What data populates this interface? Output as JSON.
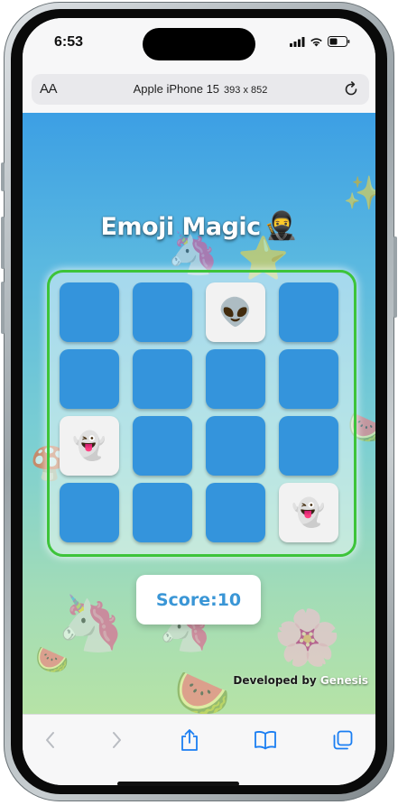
{
  "status_bar": {
    "time": "6:53"
  },
  "address_bar": {
    "text_size_label": "AA",
    "device_name": "Apple iPhone 15",
    "device_dimensions": "393 x 852"
  },
  "game": {
    "title": "Emoji Magic",
    "title_icon": "🥷",
    "cards": [
      {
        "revealed": false,
        "emoji": ""
      },
      {
        "revealed": false,
        "emoji": ""
      },
      {
        "revealed": true,
        "emoji": "👽"
      },
      {
        "revealed": false,
        "emoji": ""
      },
      {
        "revealed": false,
        "emoji": ""
      },
      {
        "revealed": false,
        "emoji": ""
      },
      {
        "revealed": false,
        "emoji": ""
      },
      {
        "revealed": false,
        "emoji": ""
      },
      {
        "revealed": true,
        "emoji": "👻"
      },
      {
        "revealed": false,
        "emoji": ""
      },
      {
        "revealed": false,
        "emoji": ""
      },
      {
        "revealed": false,
        "emoji": ""
      },
      {
        "revealed": false,
        "emoji": ""
      },
      {
        "revealed": false,
        "emoji": ""
      },
      {
        "revealed": false,
        "emoji": ""
      },
      {
        "revealed": true,
        "emoji": "👻"
      }
    ],
    "score_label": "Score:10",
    "credit_prefix": "Developed by",
    "credit_author": "Genesis"
  },
  "background_emojis": [
    "🦄",
    "⭐",
    "✨",
    "🦄",
    "🍉",
    "🌸",
    "🍉",
    "🦄",
    "🍄",
    "🍉"
  ],
  "colors": {
    "card_back": "#3494dc",
    "card_face": "#f2f2f2",
    "board_border": "#3dc43a",
    "score_text": "#3a96d6"
  },
  "toolbar": {
    "icons": [
      "back-icon",
      "forward-icon",
      "share-icon",
      "bookmarks-icon",
      "tabs-icon"
    ]
  }
}
